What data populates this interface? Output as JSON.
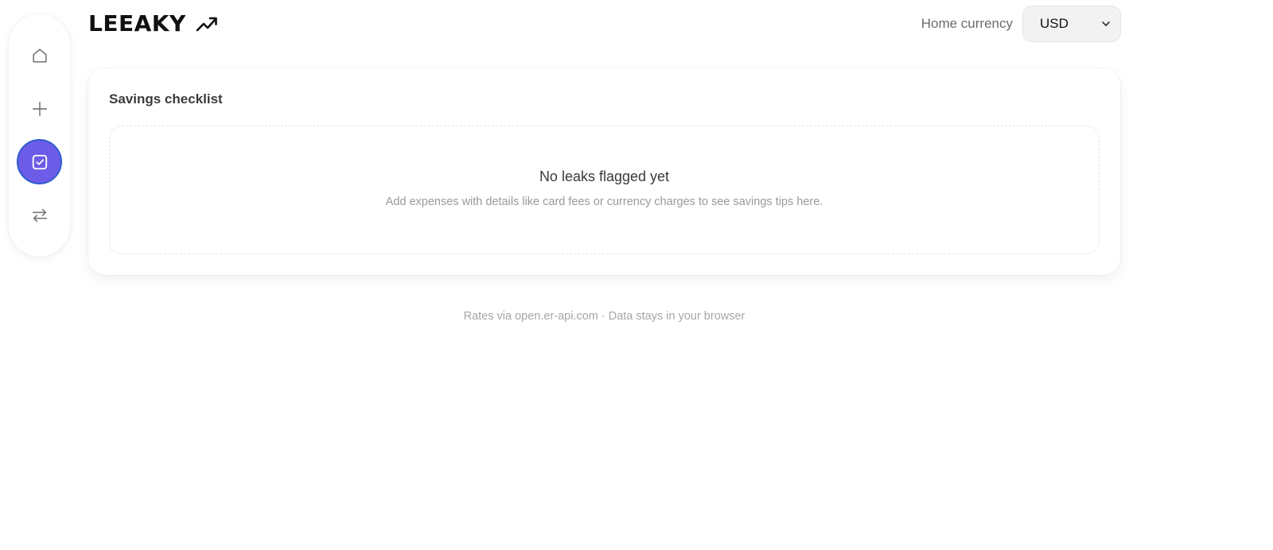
{
  "app": {
    "title": "LEEAKY",
    "logo_icon": "trending-up-icon"
  },
  "sidebar": {
    "items": [
      {
        "name": "home",
        "icon": "home-icon",
        "active": false
      },
      {
        "name": "add",
        "icon": "plus-icon",
        "active": false
      },
      {
        "name": "checklist",
        "icon": "checkbox-icon",
        "active": true
      },
      {
        "name": "convert",
        "icon": "swap-arrows-icon",
        "active": false
      }
    ],
    "accent_color": "#6c5ce7"
  },
  "header": {
    "currency_label": "Home currency",
    "currency_value": "USD"
  },
  "checklist": {
    "title": "Savings checklist",
    "empty_title": "No leaks flagged yet",
    "empty_subtitle": "Add expenses with details like card fees or currency charges to see savings tips here."
  },
  "footer": {
    "text": "Rates via open.er-api.com · Data stays in your browser"
  }
}
